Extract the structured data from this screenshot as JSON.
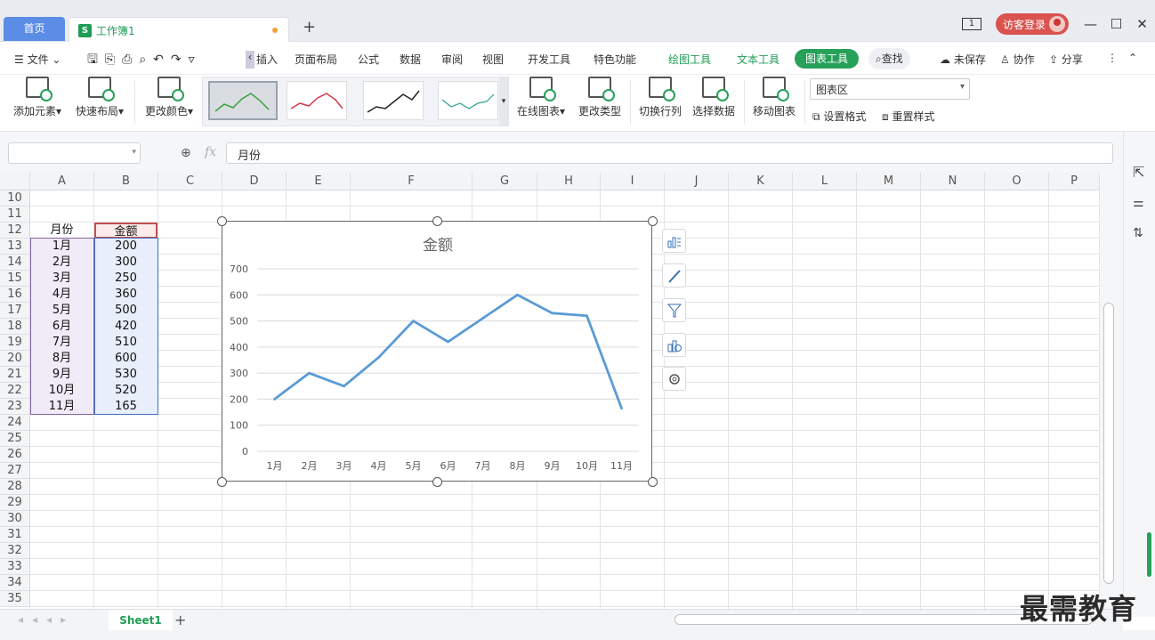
{
  "titlebar": {
    "home_tab": "首页",
    "workbook_tab": "工作簿1",
    "login_label": "访客登录",
    "page_indicator": "1"
  },
  "menu": {
    "file": "文件",
    "items": [
      "插入",
      "页面布局",
      "公式",
      "数据",
      "审阅",
      "视图",
      "开发工具",
      "特色功能"
    ],
    "draw_tools": "绘图工具",
    "text_tools": "文本工具",
    "chart_tools": "图表工具",
    "search": "查找",
    "unsaved": "未保存",
    "collab": "协作",
    "share": "分享"
  },
  "ribbon": {
    "add_element": "添加元素",
    "quick_layout": "快速布局",
    "change_color": "更改颜色",
    "online_chart": "在线图表",
    "change_type": "更改类型",
    "switch_rowcol": "切换行列",
    "select_data": "选择数据",
    "move_chart": "移动图表",
    "chart_area_select": "图表区",
    "set_format": "设置格式",
    "reset_style": "重置样式"
  },
  "formula": {
    "value": "月份"
  },
  "columns": [
    "A",
    "B",
    "C",
    "D",
    "E",
    "F",
    "G",
    "H",
    "I",
    "J",
    "K",
    "L",
    "M",
    "N",
    "O",
    "P"
  ],
  "rows": [
    "10",
    "11",
    "12",
    "13",
    "14",
    "15",
    "16",
    "17",
    "18",
    "19",
    "20",
    "21",
    "22",
    "23",
    "24",
    "25",
    "26",
    "27",
    "28",
    "29",
    "30",
    "31",
    "32",
    "33",
    "34",
    "35"
  ],
  "table": {
    "header_month": "月份",
    "header_amount": "金额",
    "months": [
      "1月",
      "2月",
      "3月",
      "4月",
      "5月",
      "6月",
      "7月",
      "8月",
      "9月",
      "10月",
      "11月"
    ],
    "amounts": [
      "200",
      "300",
      "250",
      "360",
      "500",
      "420",
      "510",
      "600",
      "530",
      "520",
      "165"
    ]
  },
  "chart_data": {
    "type": "line",
    "title": "金额",
    "categories": [
      "1月",
      "2月",
      "3月",
      "4月",
      "5月",
      "6月",
      "7月",
      "8月",
      "9月",
      "10月",
      "11月"
    ],
    "series": [
      {
        "name": "金额",
        "values": [
          200,
          300,
          250,
          360,
          500,
          420,
          510,
          600,
          530,
          520,
          165
        ]
      }
    ],
    "ylim": [
      0,
      700
    ],
    "yticks": [
      "0",
      "100",
      "200",
      "300",
      "400",
      "500",
      "600",
      "700"
    ],
    "xlabel": "",
    "ylabel": "",
    "grid": true,
    "legend": "none",
    "line_color": "#5b9bd5"
  },
  "sheet": {
    "tab": "Sheet1"
  },
  "watermark": "最需教育"
}
